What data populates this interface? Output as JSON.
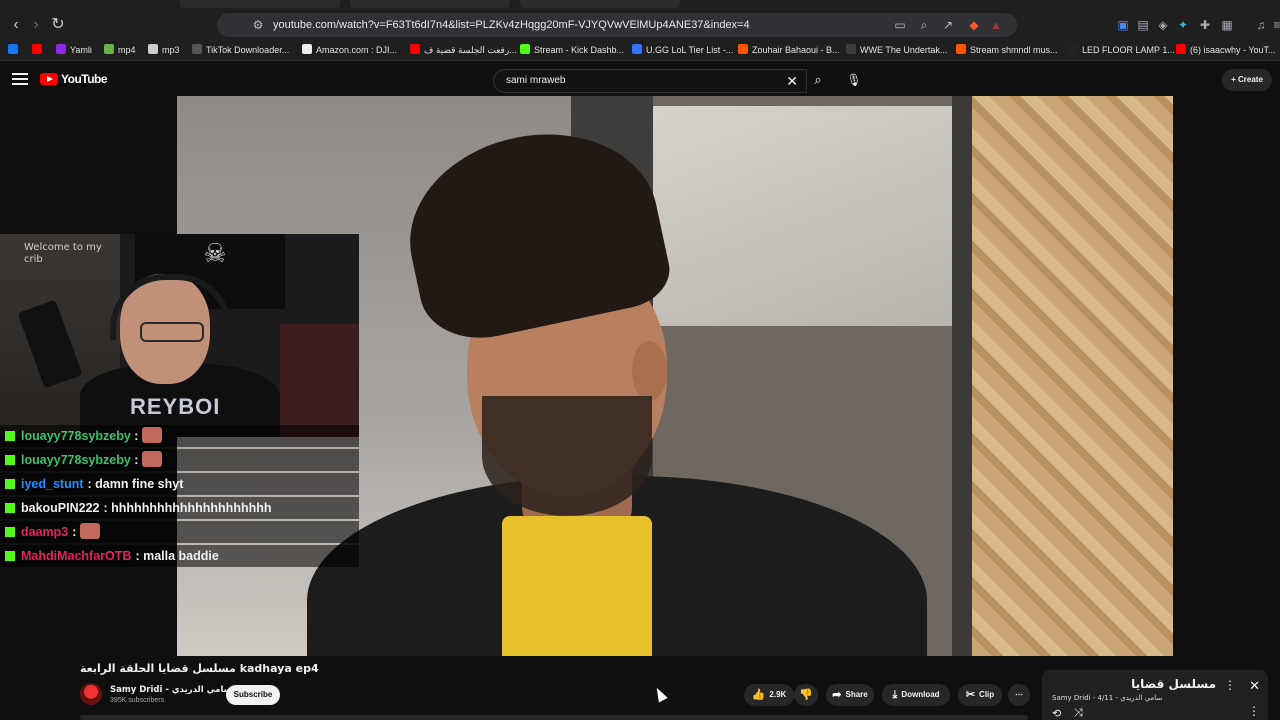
{
  "browser": {
    "url": "youtube.com/watch?v=F63Tt6dI7n4&list=PLZKv4zHqgg20mF-VJYQVwVElMUp4ANE37&index=4",
    "bookmarks": [
      {
        "label": "",
        "color": "#1877f2"
      },
      {
        "label": "",
        "color": "#ff0000"
      },
      {
        "label": "Yamli",
        "color": "#8a2be2"
      },
      {
        "label": "mp4",
        "color": "#6ab04c"
      },
      {
        "label": "mp3",
        "color": "#cccccc"
      },
      {
        "label": "TikTok Downloader...",
        "color": "#555555"
      },
      {
        "label": "Amazon.com : DJI...",
        "color": "#eeeeee"
      },
      {
        "label": "رفعت الجلسة قضية ف...",
        "color": "#ff0000"
      },
      {
        "label": "Stream - Kick Dashb...",
        "color": "#53fc18"
      },
      {
        "label": "U.GG LoL Tier List -...",
        "color": "#3273fa"
      },
      {
        "label": "Zouhair Bahaoui - B...",
        "color": "#ff5500"
      },
      {
        "label": "WWE The Undertak...",
        "color": "#3d3d3d"
      },
      {
        "label": "Stream shmndl mus...",
        "color": "#ff5500"
      },
      {
        "label": "LED FLOOR LAMP 1...",
        "color": "#222222"
      },
      {
        "label": "(6) isaacwhy - YouT...",
        "color": "#ff0000"
      }
    ]
  },
  "youtube": {
    "logo": "YouTube",
    "search_query": "sami mraweb",
    "create_label": "Create"
  },
  "webcam": {
    "sign": "Welcome to my\ncrib",
    "shirt": "REYBOI"
  },
  "chat": [
    {
      "user": "louayy778sybzeby",
      "message": "",
      "user_color": "#39c36a",
      "emote": true
    },
    {
      "user": "louayy778sybzeby",
      "message": "",
      "user_color": "#39c36a",
      "emote": true
    },
    {
      "user": "iyed_stunt",
      "message": ": damn fine shyt",
      "user_color": "#1e90ff",
      "emote": false
    },
    {
      "user": "bakouPIN222",
      "message": ": hhhhhhhhhhhhhhhhhhhhh",
      "user_color": "#f1f1f1",
      "emote": false
    },
    {
      "user": "daamp3",
      "message": ":",
      "user_color": "#e0245e",
      "emote": true
    },
    {
      "user": "MahdiMachfarOTB",
      "message": ": malla baddie",
      "user_color": "#e0245e",
      "emote": false
    }
  ],
  "video": {
    "title": "مسلسل قضايا الحلقة الرابعة kadhaya ep4",
    "channel": "Samy Dridi - سامي الدريدي",
    "subscribers": "395K subscribers",
    "subscribe_label": "Subscribe",
    "likes": "2.9K",
    "share_label": "Share",
    "download_label": "Download",
    "clip_label": "Clip"
  },
  "playlist": {
    "title": "مسلسل قضايا",
    "subtitle": "Samy Dridi - سامي الدريدي - 4/11"
  },
  "colors": {
    "background": "#0f0f0f",
    "brand_red": "#ff0000",
    "pill_bg": "#272727"
  }
}
